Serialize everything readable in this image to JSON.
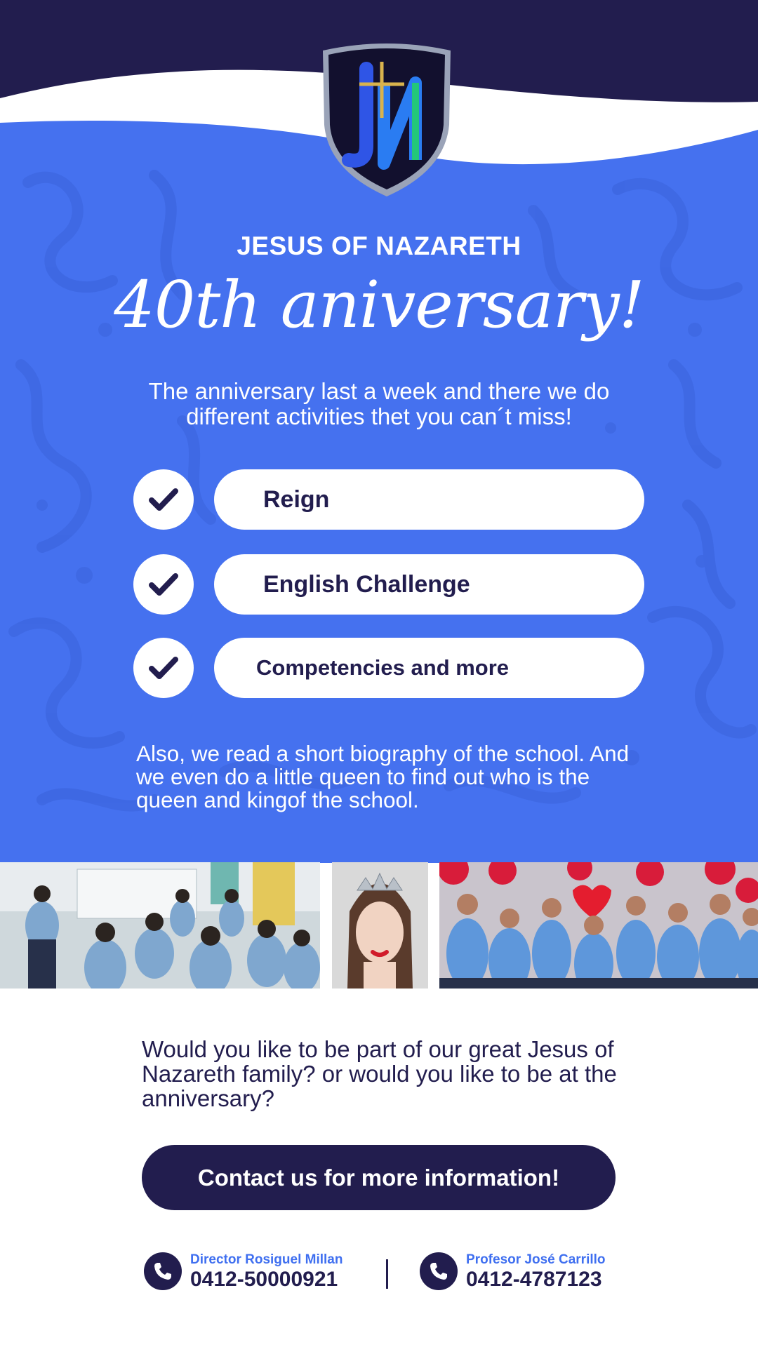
{
  "colors": {
    "navy": "#221d4e",
    "royal_blue": "#4571ef",
    "pattern_blue": "#3e68e2",
    "white": "#ffffff",
    "link_blue": "#3f6ff0"
  },
  "header": {
    "logo_icon": "jn-shield-crest-icon",
    "school_name": "JESUS OF NAZARETH",
    "title": "40th aniversary!",
    "intro": "The anniversary last a week and there we do different activities thet you can´t miss!"
  },
  "activities": [
    {
      "label": "Reign",
      "icon": "checkmark-icon"
    },
    {
      "label": "English Challenge",
      "icon": "checkmark-icon"
    },
    {
      "label": "Competencies and more",
      "icon": "checkmark-icon"
    }
  ],
  "bio_text": "Also, we read a short biography of the school. And we even do a little queen to find out who is the queen and kingof the school.",
  "photos": [
    {
      "name": "students-classroom-photo"
    },
    {
      "name": "queen-crown-photo"
    },
    {
      "name": "students-group-celebration-photo"
    }
  ],
  "invite_text": "Would you like to be part of our great Jesus of Nazareth family? or would you like to be at the anniversary?",
  "cta_label": "Contact us for more information!",
  "contacts": [
    {
      "name": "Director Rosiguel Millan",
      "phone": "0412-50000921",
      "icon": "phone-icon"
    },
    {
      "name": "Profesor José Carrillo",
      "phone": "0412-4787123",
      "icon": "phone-icon"
    }
  ]
}
